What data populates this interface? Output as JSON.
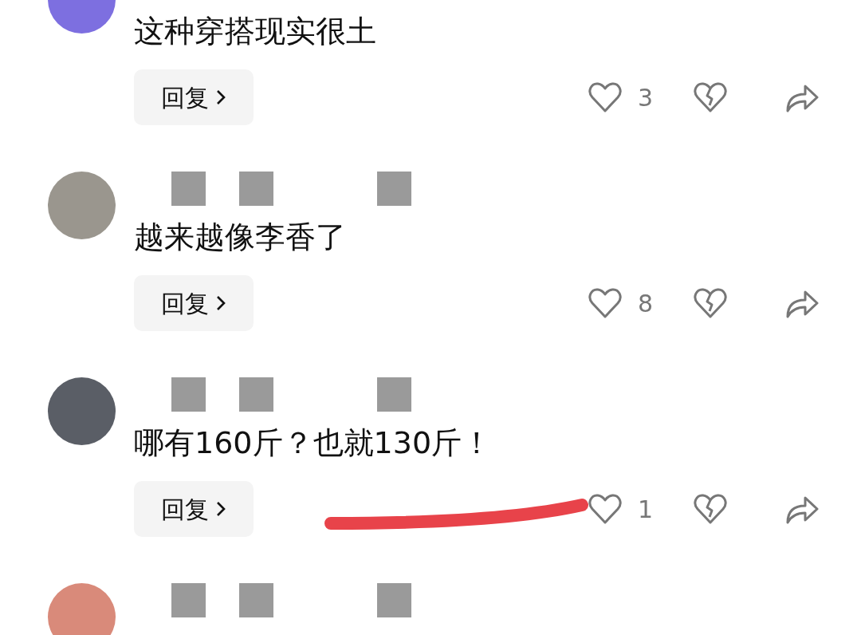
{
  "comments": [
    {
      "color": "#7d6fe0",
      "text": "这种穿搭现实很土",
      "reply": "回复",
      "likes": "3"
    },
    {
      "color": "#9a968e",
      "text": "越来越像李香了",
      "reply": "回复",
      "likes": "8"
    },
    {
      "color": "#5a5e66",
      "text": "哪有160斤？也就130斤！",
      "reply": "回复",
      "likes": "1"
    },
    {
      "color": "#d98a7a"
    }
  ]
}
